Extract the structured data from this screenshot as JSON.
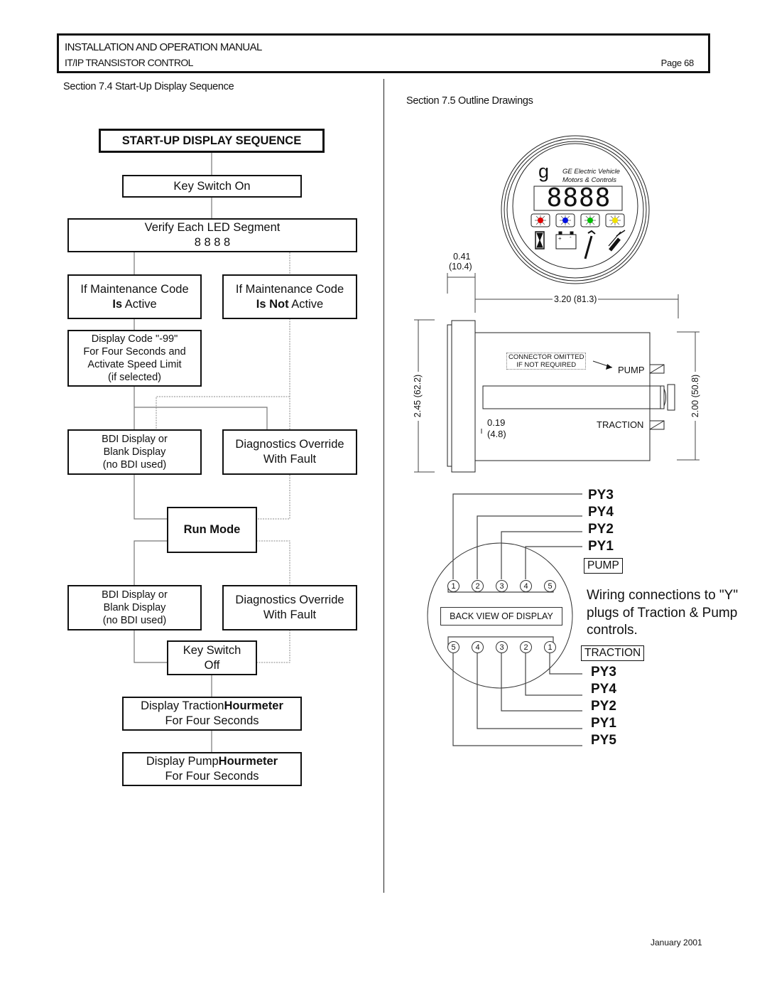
{
  "header": {
    "line1": "INSTALLATION AND OPERATION MANUAL",
    "line2": "IT/IP TRANSISTOR CONTROL",
    "page": "Page 68"
  },
  "left_section": {
    "title": "Section 7.4 Start-Up Display Sequence",
    "flowchart": {
      "title": "START-UP DISPLAY SEQUENCE",
      "key_on": "Key Switch On",
      "verify": [
        "Verify Each LED Segment",
        "8 8 8 8"
      ],
      "maint_active": {
        "line1": "If Maintenance Code",
        "bold": "Is",
        "rest": " Active"
      },
      "maint_not_active": {
        "line1": "If Maintenance Code",
        "bold": "Is Not",
        "rest": " Active"
      },
      "display_code": [
        "Display Code \"-99\"",
        "For Four Seconds and",
        "Activate Speed Limit",
        "(if selected)"
      ],
      "bdi_1": [
        "BDI Display or",
        "Blank Display",
        "(no BDI used)"
      ],
      "diag_1": [
        "Diagnostics Override",
        "With Fault"
      ],
      "run_mode": "Run Mode",
      "bdi_2": [
        "BDI Display or",
        "Blank Display",
        "(no BDI used)"
      ],
      "diag_2": [
        "Diagnostics Override",
        "With Fault"
      ],
      "key_off": [
        "Key Switch",
        "Off"
      ],
      "traction_hour": {
        "prefix": "Display Traction",
        "bold": "Hourmeter",
        "line2": "For Four Seconds"
      },
      "pump_hour": {
        "prefix": "Display Pump",
        "bold": "Hourmeter",
        "line2": "For Four Seconds"
      }
    }
  },
  "right_section": {
    "title": "Section 7.5 Outline Drawings",
    "gauge": {
      "logo": "g",
      "brand_line1": "GE Electric Vehicle",
      "brand_line2": "Motors & Controls",
      "display_digits": "8888",
      "led_colors": [
        "#e00000",
        "#0010e0",
        "#00c000",
        "#f0e000"
      ],
      "icons": [
        "hourglass-icon",
        "battery-icon",
        "wrench-icon",
        "grease-gun-icon"
      ],
      "battery_plus": "+",
      "battery_minus": "-"
    },
    "dimensions": {
      "bezel_depth": [
        "0.41",
        "(10.4)"
      ],
      "body_length": "3.20 (81.3)",
      "overall_height": "2.45 (62.2)",
      "body_height": "2.00 (50.8)",
      "gap": [
        "0.19",
        "(4.8)"
      ]
    },
    "side_view": {
      "connector_note": [
        "CONNECTOR OMITTED",
        "IF NOT REQUIRED"
      ],
      "pump_label": "PUMP",
      "traction_label": "TRACTION"
    },
    "back_view": {
      "label": "BACK VIEW OF DISPLAY",
      "top_pins": [
        "1",
        "2",
        "3",
        "4",
        "5"
      ],
      "bottom_pins": [
        "5",
        "4",
        "3",
        "2",
        "1"
      ],
      "pump_box": "PUMP",
      "traction_box": "TRACTION",
      "pump_wires": [
        "PY3",
        "PY4",
        "PY2",
        "PY1"
      ],
      "traction_wires": [
        "PY3",
        "PY4",
        "PY2",
        "PY1",
        "PY5"
      ],
      "note": [
        "Wiring connections to \"Y\"",
        "plugs of Traction & Pump",
        "controls."
      ]
    }
  },
  "footer": {
    "date": "January 2001"
  }
}
